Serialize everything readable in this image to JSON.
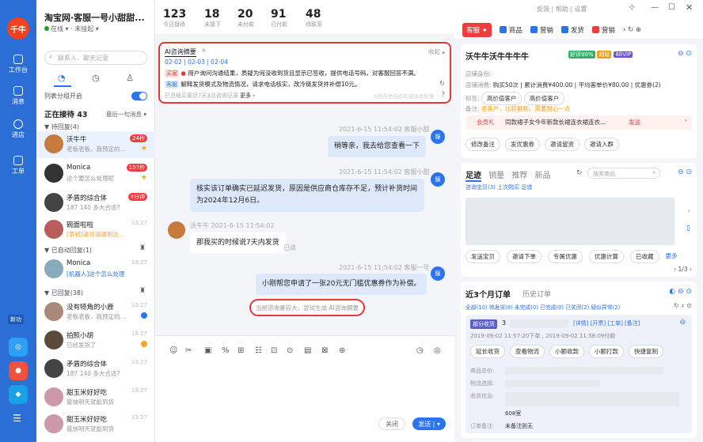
{
  "nav": {
    "logo": "千牛",
    "items": [
      {
        "label": "工作台",
        "icon": "workbench-icon"
      },
      {
        "label": "消息",
        "icon": "message-icon"
      },
      {
        "label": "进店",
        "icon": "store-icon"
      },
      {
        "label": "工单",
        "icon": "ticket-icon"
      }
    ],
    "bottom_badge": "新功"
  },
  "conv_list": {
    "shop": "淘宝网·客服一号小甜甜...",
    "status": "在线 ▾",
    "status2": "未挂起 ▾",
    "search_placeholder": "联系人、聊天记录",
    "group_toggle_label": "列表分组开启",
    "receiving": "正在接待 43",
    "sort": "最后一句消息 ▾",
    "groups": {
      "pending": "▼ 待回复(4)",
      "auto": "▼ 已自动回复(1)",
      "replied": "▼ 已回复(38)"
    },
    "items": [
      {
        "name": "沃牛牛",
        "msg": "老板老板，我预定的...",
        "time": "24秒",
        "badge": true
      },
      {
        "name": "Monica",
        "msg": "这个要怎么处理呢",
        "time": "157秒",
        "badge": true
      },
      {
        "name": "矛盾的综合体",
        "msg": "187 140 多大合适?",
        "time": "4分钟",
        "badge": true
      },
      {
        "name": "碗面啦啦",
        "msg": "[草稿]请货请通到达...",
        "time": "13:27"
      },
      {
        "name": "Monica",
        "msg": "[机器人]这个怎么处理",
        "time": "13:27"
      },
      {
        "name": "没有犄角的小鹿",
        "msg": "老板老板，我预定的...",
        "time": "13:27"
      },
      {
        "name": "拍照小胡",
        "msg": "已经发货了",
        "time": "13:27"
      },
      {
        "name": "矛盾的综合体",
        "msg": "187 140 多大合适?",
        "time": "13:27"
      },
      {
        "name": "甜玉米好好吃",
        "msg": "最快明天就能到货",
        "time": "13:27"
      },
      {
        "name": "甜玉米好好吃",
        "msg": "最快明天就能到货",
        "time": "13:27"
      }
    ]
  },
  "stats": [
    {
      "num": "123",
      "label": "今日接待"
    },
    {
      "num": "18",
      "label": "未接下"
    },
    {
      "num": "20",
      "label": "未付款"
    },
    {
      "num": "91",
      "label": "已付款"
    },
    {
      "num": "48",
      "label": "待联系"
    }
  ],
  "summary": {
    "title": "AI咨询摘要",
    "collapse": "收起 ▴",
    "dates": "02-02 | 02-03 | 02-04",
    "line1_tag": "买家",
    "line1": "用户询问沟通结果，质疑为何没收到货且显示已签收，提供电话号码，对客服回答不满。",
    "line2_tag": "客服",
    "line2": "解释发货模式及物流情况，请求电话核实，改冷链发货并补偿10元。",
    "footer": "已总结买家近7天3次咨询记录",
    "more": "更多 ›",
    "footer_right": "5月内总结如有错误请反馈"
  },
  "chat": [
    {
      "meta": "2021-6-15 11:54:02  客服小甜",
      "text": "稍等亲，我去给您查看一下",
      "side": "right"
    },
    {
      "meta": "2021-6-15 11:54:02  客服小甜",
      "text": "核实该订单确实已延迟发货，原因是供应商仓库存不足，预计补货时间为2024年12月6日。",
      "side": "right"
    },
    {
      "meta": "沃牛牛  2021-6-15 11:54:02",
      "text": "那我买的时候说7天内发货",
      "side": "left",
      "read": "已读"
    },
    {
      "meta": "2021-6-15 11:54:02  客服一号",
      "text": "小刚帮您申请了一张20元无门槛优惠券作为补偿。",
      "side": "right"
    }
  ],
  "tip": "当前咨询量较大，尝试生成 AI咨询摘要",
  "input": {
    "close": "关闭",
    "send": "发送 | ▾"
  },
  "right": {
    "topbar": "反馈 | 帮助 | 设置",
    "tabs": [
      "客服 ✦",
      "商品",
      "营销",
      "发货",
      "营销"
    ],
    "customer": {
      "name": "沃牛牛沃牛牛牛牛",
      "tags": [
        "好评90%",
        "超级",
        "88VIP"
      ],
      "identity_label": "店铺身份:",
      "spend_label": "店铺消费:",
      "spend": "购买50次 | 累计消费¥400.00 | 平均客单价¥80.00 | 优惠券(2)",
      "tag_label": "标签:",
      "tags2": [
        "高价值客户",
        "高价值客户"
      ],
      "note_label": "备注:",
      "note": "老客户，比较挑剔，需要耐心一点",
      "promo_tag": "会员礼",
      "promo": "同款裙子女今年新款长裙连衣裙连衣...",
      "promo_send": "发送",
      "actions": [
        "修改备注",
        "发优惠券",
        "邀请留资",
        "邀请入群"
      ]
    },
    "goods": {
      "tabs": [
        "足迹",
        "销量",
        "推荐",
        "新品"
      ],
      "search": "搜索商品",
      "sub": "咨询宝贝(3)  上次购买  足迹",
      "actions": [
        "发送宝贝",
        "邀请下单",
        "专属优惠",
        "优惠计算",
        "已收藏",
        "更多"
      ],
      "page": "‹  1/3  ›"
    },
    "orders": {
      "title": "近3个月订单",
      "history": "历史订单",
      "filters": "全部(10)  待发货(8)  未完成(0)  已完成(0)  已关闭(2)  疑似异常(2)",
      "status": "部分收货",
      "order_no": "3",
      "links": "[详情] [开票] [工单] [备注]",
      "time": "2019-09-02 11:57:20下单 , 2019-09-02 11:58:09付款",
      "actions": [
        "延长收货",
        "查看物流",
        "小额收款",
        "小额打款",
        "快捷复制"
      ],
      "price_label": "商品总价:",
      "ship_label": "物流选择:",
      "addr_label": "收货信息:",
      "addr_tail": "608室",
      "remark_label": "订单备注:",
      "remark": "未备注则无"
    }
  }
}
